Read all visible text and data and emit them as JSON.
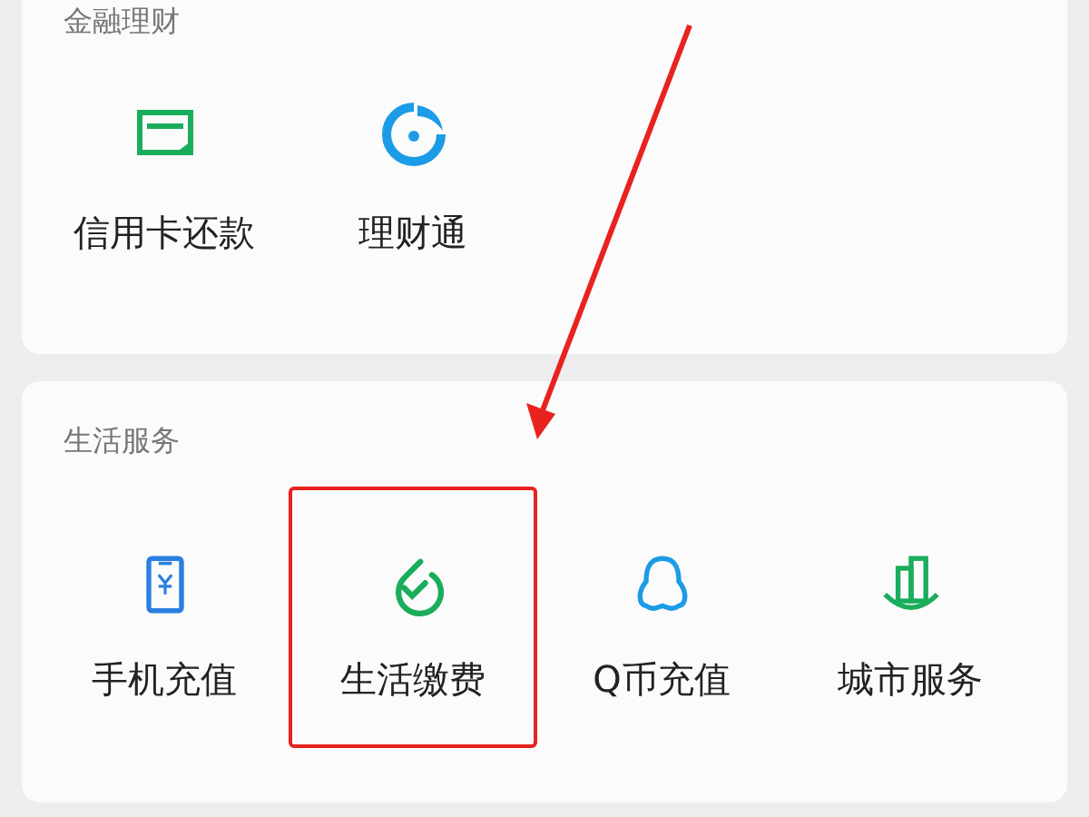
{
  "sections": [
    {
      "title": "金融理财",
      "items": [
        {
          "label": "信用卡还款",
          "highlighted": false
        },
        {
          "label": "理财通",
          "highlighted": false
        }
      ]
    },
    {
      "title": "生活服务",
      "items": [
        {
          "label": "手机充值",
          "highlighted": false
        },
        {
          "label": "生活缴费",
          "highlighted": true
        },
        {
          "label": "Q币充值",
          "highlighted": false
        },
        {
          "label": "城市服务",
          "highlighted": false
        }
      ]
    }
  ]
}
